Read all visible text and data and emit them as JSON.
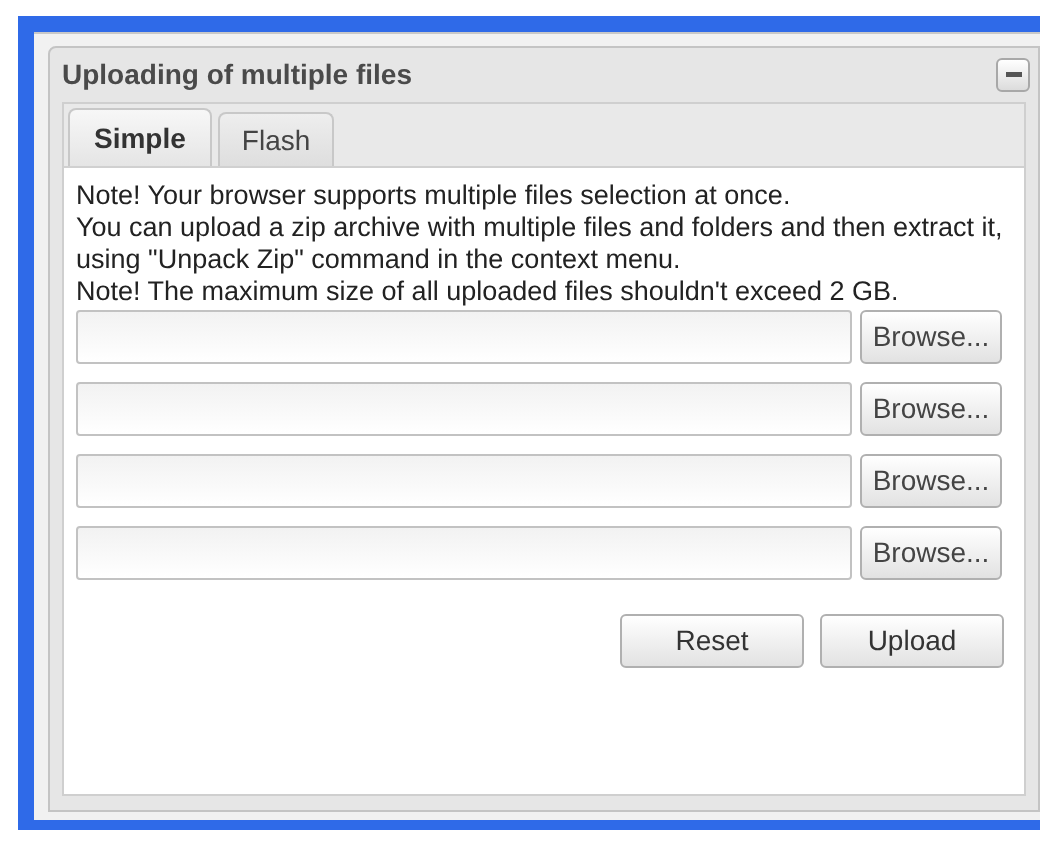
{
  "dialog": {
    "title": "Uploading of multiple files"
  },
  "tabs": [
    {
      "label": "Simple",
      "selected": true
    },
    {
      "label": "Flash",
      "selected": false
    }
  ],
  "notes": [
    "Note! Your browser supports multiple files selection at once.",
    "You can upload a zip archive with multiple files and folders and then extract it, using \"Unpack Zip\" command in the context menu.",
    "Note! The maximum size of all uploaded files shouldn't exceed 2 GB."
  ],
  "file_rows": [
    {
      "button": "Browse..."
    },
    {
      "button": "Browse..."
    },
    {
      "button": "Browse..."
    },
    {
      "button": "Browse..."
    }
  ],
  "actions": [
    "Reset",
    "Upload"
  ]
}
